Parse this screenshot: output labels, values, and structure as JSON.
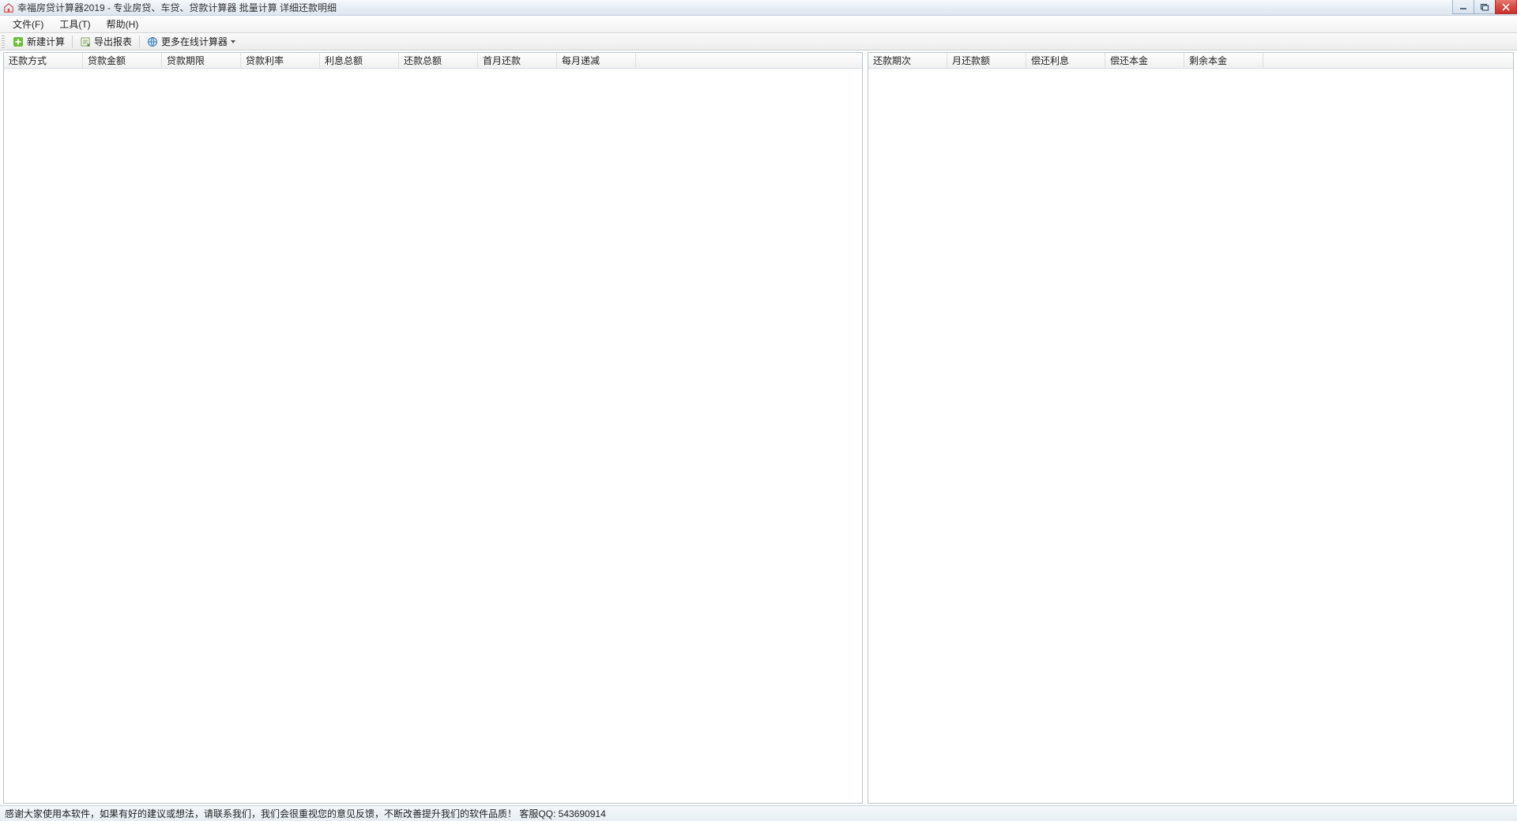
{
  "window": {
    "title": "幸福房贷计算器2019 - 专业房贷、车贷、贷款计算器 批量计算 详细还款明细"
  },
  "menu": {
    "file": "文件(F)",
    "tools": "工具(T)",
    "help": "帮助(H)"
  },
  "toolbar": {
    "new_calc": "新建计算",
    "export": "导出报表",
    "more": "更多在线计算器"
  },
  "left_columns": [
    "还款方式",
    "贷款金额",
    "贷款期限",
    "贷款利率",
    "利息总额",
    "还款总额",
    "首月还款",
    "每月递减"
  ],
  "right_columns": [
    "还款期次",
    "月还款额",
    "偿还利息",
    "偿还本金",
    "剩余本金"
  ],
  "status": {
    "text": "感谢大家使用本软件，如果有好的建议或想法，请联系我们，我们会很重视您的意见反馈，不断改善提升我们的软件品质！ 客服QQ: 543690914"
  }
}
